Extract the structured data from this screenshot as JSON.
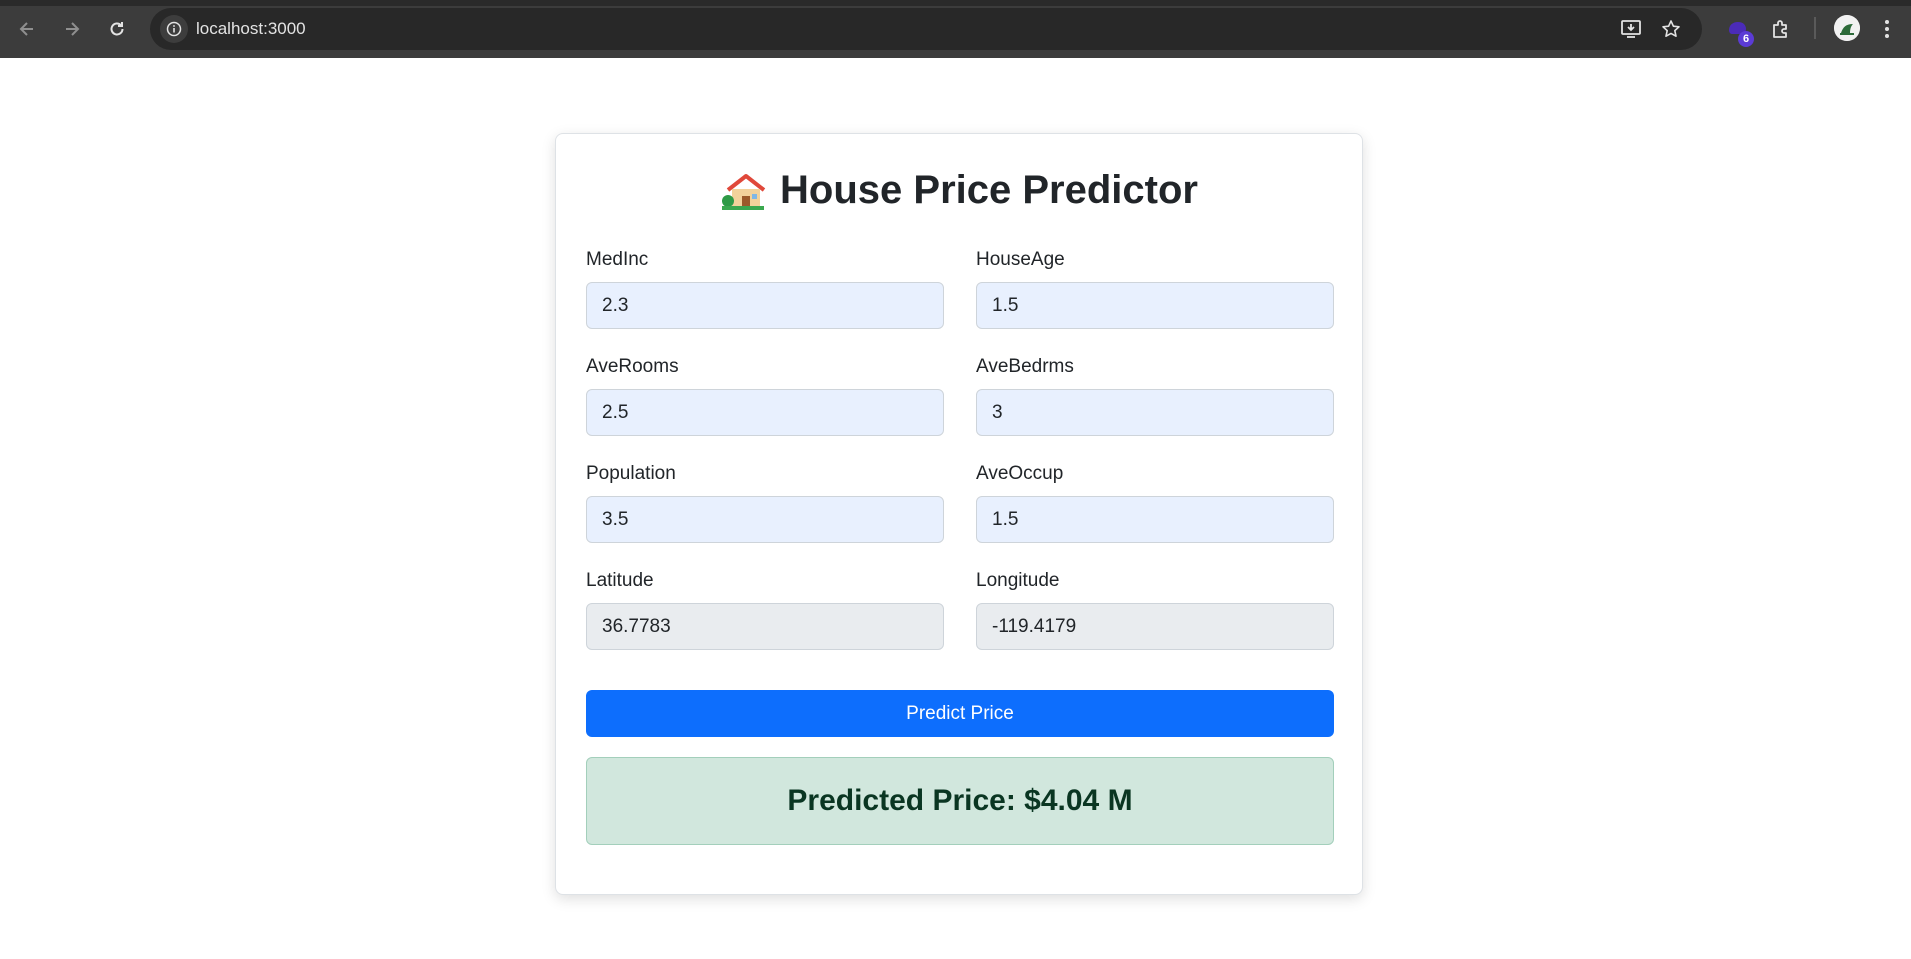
{
  "browser": {
    "url": "localhost:3000",
    "extension_badge": "6",
    "icons": {
      "back": "arrow-left-icon",
      "forward": "arrow-right-icon",
      "reload": "reload-icon",
      "site_info": "info-icon",
      "install": "install-app-icon",
      "bookmark": "star-icon",
      "extension": "extension-icon",
      "puzzle": "puzzle-icon",
      "menu": "kebab-menu-icon"
    }
  },
  "app": {
    "title": "House Price Predictor",
    "title_icon": "house-icon",
    "fields": [
      {
        "label": "MedInc",
        "value": "2.3",
        "readonly": false
      },
      {
        "label": "HouseAge",
        "value": "1.5",
        "readonly": false
      },
      {
        "label": "AveRooms",
        "value": "2.5",
        "readonly": false
      },
      {
        "label": "AveBedrms",
        "value": "3",
        "readonly": false
      },
      {
        "label": "Population",
        "value": "3.5",
        "readonly": false
      },
      {
        "label": "AveOccup",
        "value": "1.5",
        "readonly": false
      },
      {
        "label": "Latitude",
        "value": "36.7783",
        "readonly": true
      },
      {
        "label": "Longitude",
        "value": "-119.4179",
        "readonly": true
      }
    ],
    "predict_button": "Predict Price",
    "result": "Predicted Price: $4.04 M"
  },
  "colors": {
    "primary": "#0d6efd",
    "input_bg": "#e8f0fe",
    "readonly_bg": "#e9ecef",
    "success_bg": "#d1e7dd",
    "success_text": "#0a3622"
  }
}
